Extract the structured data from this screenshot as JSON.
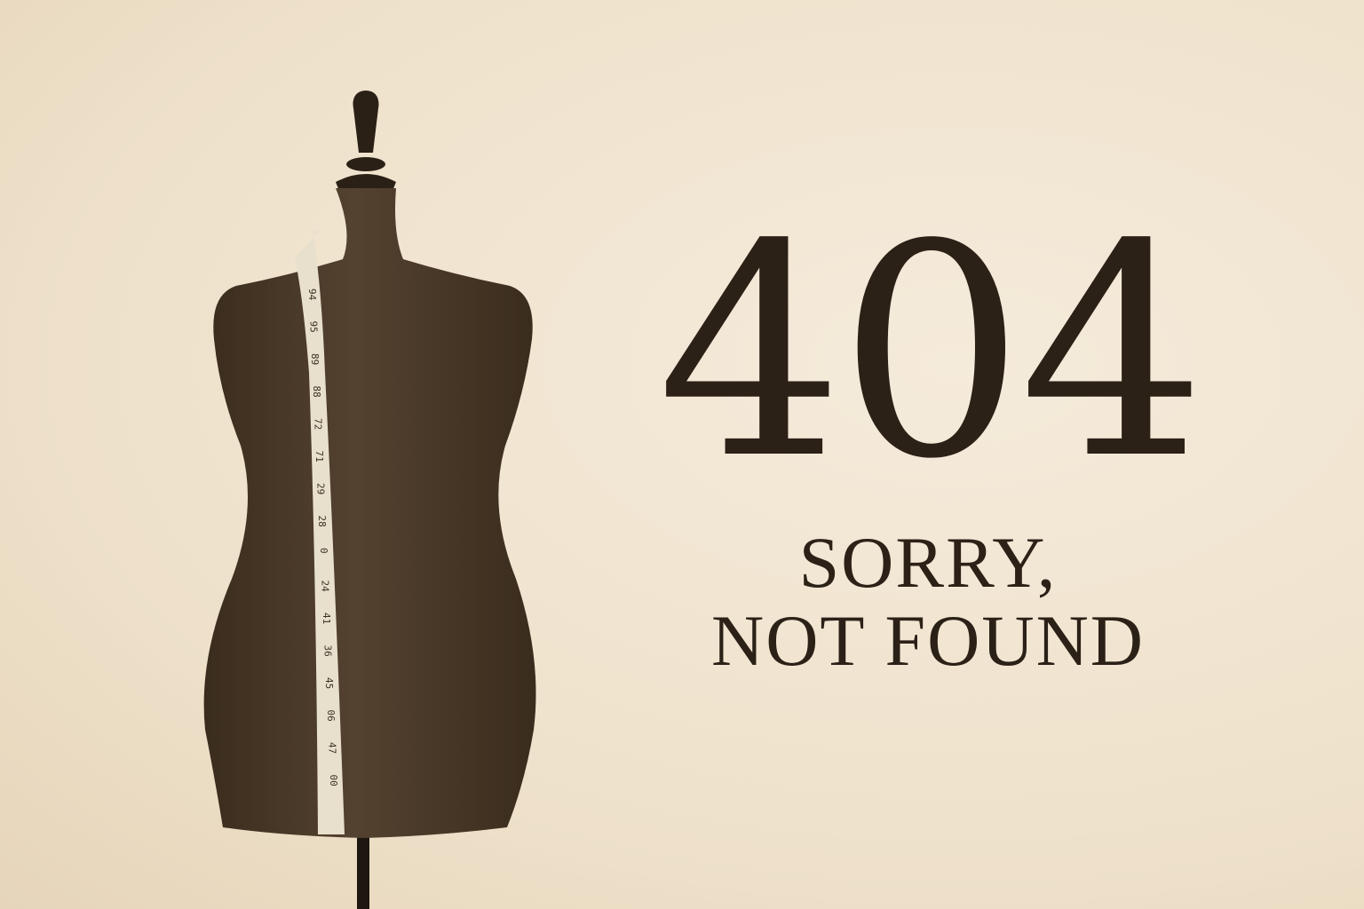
{
  "error": {
    "code": "404",
    "message_line1": "SORRY,",
    "message_line2": "NOT FOUND"
  },
  "illustration": {
    "subject": "dress-form-mannequin",
    "tape_marks": [
      "94",
      "95",
      "89",
      "88",
      "72",
      "71",
      "29",
      "28",
      "0",
      "24",
      "41",
      "36",
      "45",
      "06",
      "47",
      "00"
    ]
  },
  "colors": {
    "background": "#f0e4cf",
    "text": "#2b2117",
    "mannequin": "#4a3a28",
    "tape": "#e8e0cc"
  }
}
